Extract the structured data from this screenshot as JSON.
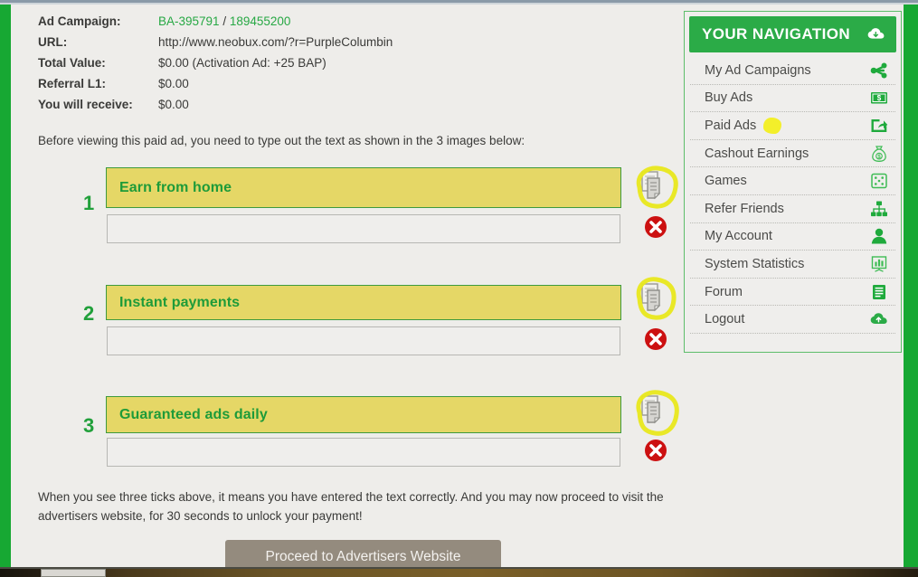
{
  "details": {
    "rows": [
      {
        "label": "Ad Campaign:",
        "value": "",
        "link1": "BA-395791",
        "sep": " / ",
        "link2": "189455200"
      },
      {
        "label": "URL:",
        "value": "http://www.neobux.com/?r=PurpleColumbin"
      },
      {
        "label": "Total Value:",
        "value": "$0.00 (Activation Ad: +25 BAP)"
      },
      {
        "label": "Referral L1:",
        "value": "$0.00"
      },
      {
        "label": "You will receive:",
        "value": "$0.00"
      }
    ]
  },
  "instruction": "Before viewing this paid ad, you need to type out the text as shown in the 3 images below:",
  "captchas": [
    {
      "number": "1",
      "phrase": "Earn from home",
      "input_value": "",
      "status": "invalid"
    },
    {
      "number": "2",
      "phrase": "Instant payments",
      "input_value": "",
      "status": "invalid"
    },
    {
      "number": "3",
      "phrase": "Guaranteed ads daily",
      "input_value": "",
      "status": "invalid"
    }
  ],
  "footer": {
    "note": "When you see three ticks above, it means you have entered the text correctly. And you may now proceed to visit the advertisers website, for 30 seconds to unlock your payment!",
    "proceed_label": "Proceed to Advertisers Website"
  },
  "navigation": {
    "title": "YOUR NAVIGATION",
    "header_icon": "cloud-download-icon",
    "items": [
      {
        "label": "My Ad Campaigns",
        "icon": "share-network-icon"
      },
      {
        "label": "Buy Ads",
        "icon": "money-bill-icon"
      },
      {
        "label": "Paid Ads",
        "icon": "share-box-icon",
        "highlighted": true
      },
      {
        "label": "Cashout Earnings",
        "icon": "money-bag-icon"
      },
      {
        "label": "Games",
        "icon": "dice-icon"
      },
      {
        "label": "Refer Friends",
        "icon": "org-chart-icon"
      },
      {
        "label": "My Account",
        "icon": "user-icon"
      },
      {
        "label": "System Statistics",
        "icon": "chart-board-icon"
      },
      {
        "label": "Forum",
        "icon": "forum-list-icon"
      },
      {
        "label": "Logout",
        "icon": "cloud-upload-icon"
      }
    ]
  },
  "colors": {
    "brand_green": "#2bab47",
    "link_green": "#27a844",
    "captcha_bg": "#e5d766",
    "captcha_text": "#1e9b39",
    "error_red": "#cc1111",
    "highlighter_yellow": "#e8e81c",
    "button_disabled": "#948b7e",
    "page_bg": "#eeedea"
  }
}
